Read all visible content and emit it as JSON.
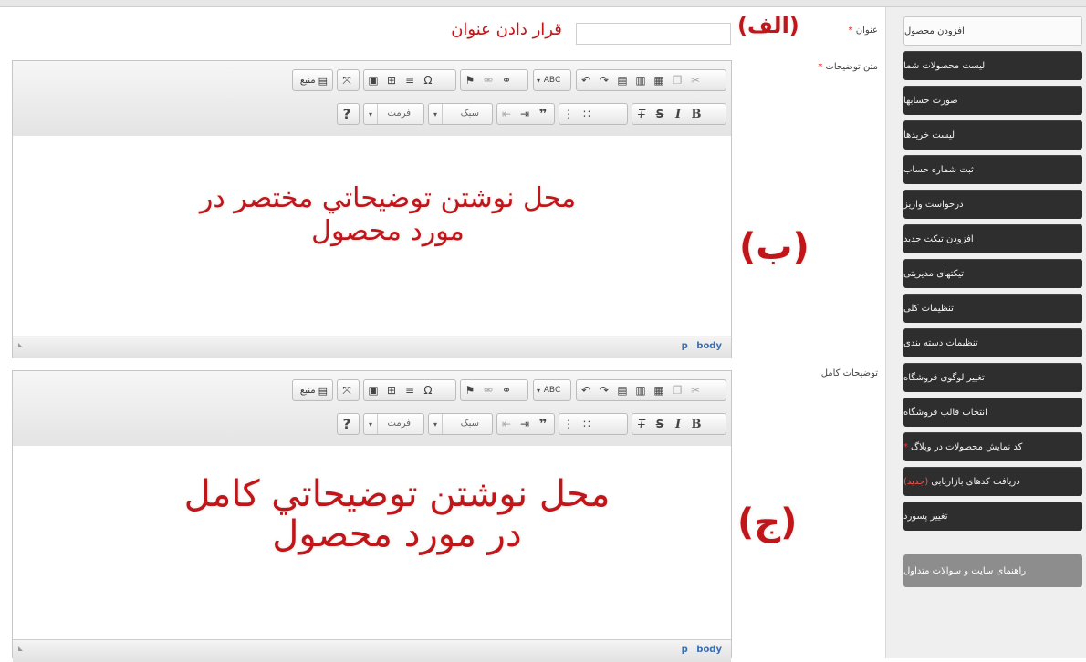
{
  "sidebar": {
    "items": [
      {
        "label": "افزودن محصول",
        "active": true
      },
      {
        "label": "لیست محصولات شما"
      },
      {
        "label": "صورت حسابها"
      },
      {
        "label": "لیست خریدها"
      },
      {
        "label": "ثبت شماره حساب"
      },
      {
        "label": "درخواست واریز"
      },
      {
        "label": "افزودن تیکت جدید"
      },
      {
        "label": "تیکتهای مدیریتی"
      },
      {
        "label": "تنظیمات کلی"
      },
      {
        "label": "تنظیمات دسته بندی"
      },
      {
        "label": "تغییر لوگوی فروشگاه"
      },
      {
        "label": "انتخاب قالب فروشگاه"
      },
      {
        "label": "کد نمایش محصولات در وبلاگ",
        "star": "*"
      },
      {
        "label": "دریافت کدهای بازاریابی",
        "badge": "(جدید)"
      },
      {
        "label": "تغییر پسورد"
      }
    ],
    "help_label": "راهنمای سایت و سوالات متداول"
  },
  "form": {
    "title_label": "عنوان",
    "desc_label": "متن توضیحات",
    "full_label": "توضیحات کامل",
    "required_mark": "*",
    "title_value": ""
  },
  "toolbar": {
    "source_label": "منبع",
    "style_label": "سبک",
    "format_label": "فرمت",
    "help_label": "?"
  },
  "editor_path": "p body",
  "annotations": {
    "alef": "(الف)",
    "title_hint": "قرار دادن عنوان",
    "be": "(ب)",
    "short_desc": "محل نوشتن توضیحاتي مختصر در مورد محصول",
    "jim": "(ج)",
    "full_desc": "محل نوشتن توضیحاتي کامل در مورد محصول"
  },
  "colors": {
    "annotation": "#c0161a",
    "sidebar_dark": "#2e2e2e",
    "path_link": "#3a6fb0"
  }
}
